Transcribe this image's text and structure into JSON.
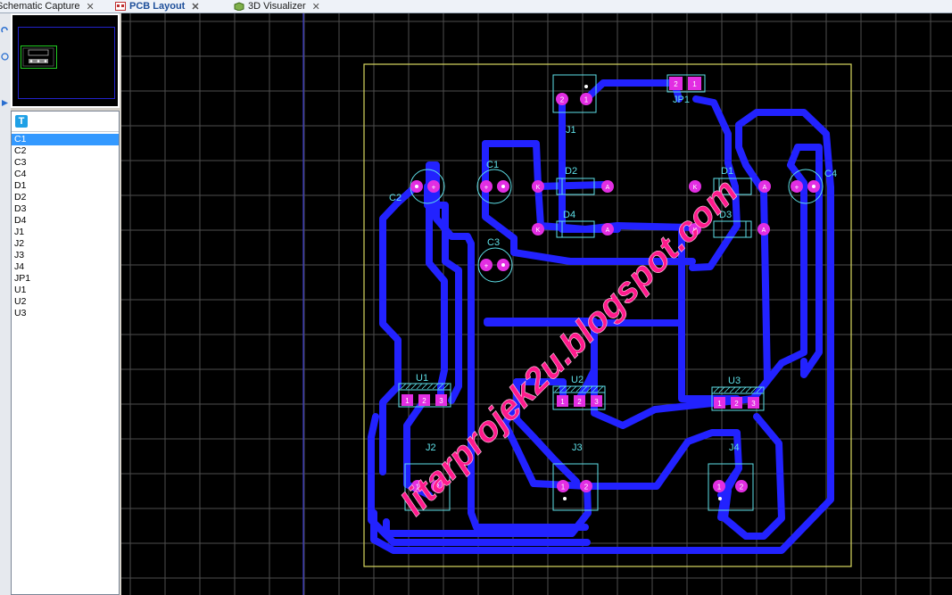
{
  "tabs": [
    {
      "label": "Schematic Capture",
      "icon": "schematic-icon",
      "active": false
    },
    {
      "label": "PCB Layout",
      "icon": "pcb-icon",
      "active": true
    },
    {
      "label": "3D Visualizer",
      "icon": "3d-icon",
      "active": false
    }
  ],
  "tab_close_glyph": "✕",
  "panel": {
    "toolbar_icon": "text-tool-icon",
    "toolbar_glyph": "T",
    "selected": "C1",
    "components": [
      "C1",
      "C2",
      "C3",
      "C4",
      "D1",
      "D2",
      "D3",
      "D4",
      "J1",
      "J2",
      "J3",
      "J4",
      "JP1",
      "U1",
      "U2",
      "U3"
    ]
  },
  "pcb": {
    "labels": {
      "C1": "C1",
      "C2": "C2",
      "C3": "C3",
      "C4": "C4",
      "D1": "D1",
      "D2": "D2",
      "D3": "D3",
      "D4": "D4",
      "J1": "J1",
      "J2": "J2",
      "J3": "J3",
      "J4": "J4",
      "JP1": "JP1",
      "U1": "U1",
      "U2": "U2",
      "U3": "U3"
    },
    "pin": {
      "one": "1",
      "two": "2",
      "three": "3",
      "plus": "+",
      "anode": "A",
      "cathode": "K"
    },
    "watermark": "litarprojek2u.blogspot.com"
  },
  "colors": {
    "track": "#2222ff",
    "pad": "#e22ee2",
    "silk": "#5ee0e8",
    "board_edge": "#d8d860",
    "grid": "#4e4e4e",
    "watermark": "#ff1a8c"
  }
}
